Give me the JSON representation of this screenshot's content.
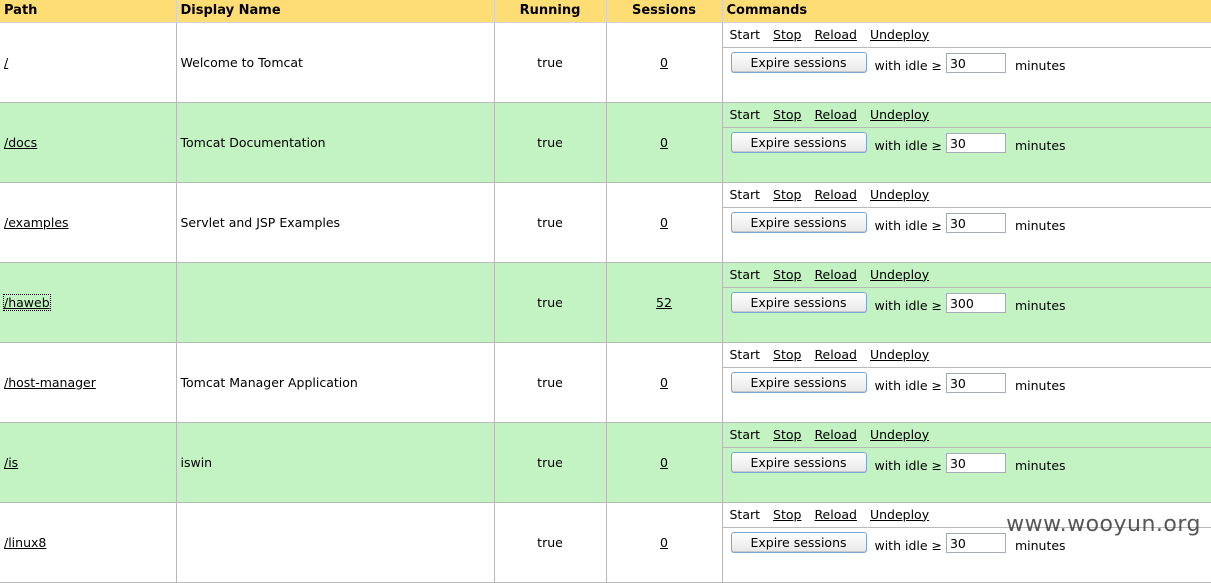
{
  "headers": {
    "path": "Path",
    "display_name": "Display Name",
    "running": "Running",
    "sessions": "Sessions",
    "commands": "Commands"
  },
  "commands": {
    "start": "Start",
    "stop": "Stop",
    "reload": "Reload",
    "undeploy": "Undeploy",
    "expire_button": "Expire sessions",
    "with_idle": "with idle ≥",
    "minutes": "minutes"
  },
  "rows": [
    {
      "path": "/",
      "display_name": "Welcome to Tomcat",
      "running": "true",
      "sessions": "0",
      "idle": "30"
    },
    {
      "path": "/docs",
      "display_name": "Tomcat Documentation",
      "running": "true",
      "sessions": "0",
      "idle": "30"
    },
    {
      "path": "/examples",
      "display_name": "Servlet and JSP Examples",
      "running": "true",
      "sessions": "0",
      "idle": "30"
    },
    {
      "path": "/haweb",
      "display_name": "",
      "running": "true",
      "sessions": "52",
      "idle": "300"
    },
    {
      "path": "/host-manager",
      "display_name": "Tomcat Manager Application",
      "running": "true",
      "sessions": "0",
      "idle": "30"
    },
    {
      "path": "/is",
      "display_name": "iswin",
      "running": "true",
      "sessions": "0",
      "idle": "30"
    },
    {
      "path": "/linux8",
      "display_name": "",
      "running": "true",
      "sessions": "0",
      "idle": "30"
    }
  ],
  "watermark": "www.wooyun.org",
  "colors": {
    "header_bg": "#ffdd75",
    "row_alt_bg": "#c3f3c3",
    "row_bg": "#ffffff"
  }
}
